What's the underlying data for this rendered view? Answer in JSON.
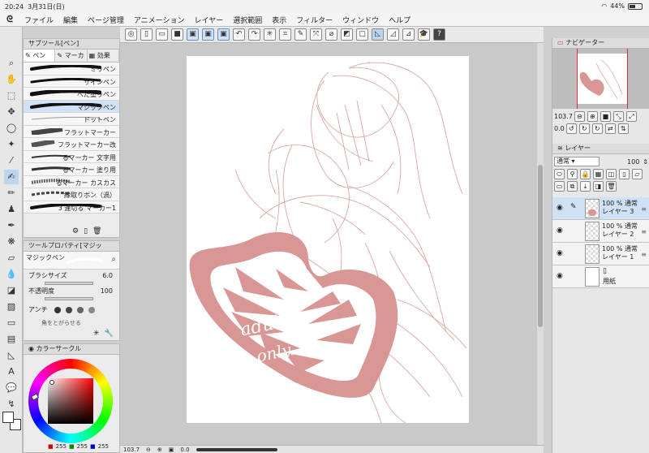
{
  "status": {
    "time": "20:24",
    "date": "3月31日(日)",
    "battery": "44%"
  },
  "menu": [
    "ファイル",
    "編集",
    "ページ管理",
    "アニメーション",
    "レイヤー",
    "選択範囲",
    "表示",
    "フィルター",
    "ウィンドウ",
    "ヘルプ"
  ],
  "subtool": {
    "header": "サブツール[ペン]",
    "tabs": [
      "ペン",
      "マーカ",
      "効果"
    ],
    "brushes": [
      "ミリペン",
      "サインペン",
      "べた塗りペン",
      "マジックペン",
      "ドットペン",
      "フラットマーカー",
      "フラットマーカー改",
      "るマーカー 文字用",
      "るマーカー 塗り用",
      "るマーカー カスカス",
      "縁取りボン（渦）",
      "3 連切る マーカー1"
    ]
  },
  "toolprop": {
    "header": "ツールプロパティ[マジッ",
    "brush_name": "マジックペン",
    "size_label": "ブラシサイズ",
    "size_value": "6.0",
    "opacity_label": "不透明度",
    "opacity_value": "100",
    "aa_label": "アンチ",
    "extra_label": "角をとがらせる"
  },
  "color": {
    "header": "カラーサークル",
    "r": "255",
    "g": "255",
    "b": "255",
    "accent": "#d89694"
  },
  "canvas": {
    "text_line1": "adult",
    "text_line2": "only...",
    "sketch_color": "#d89694"
  },
  "bottom": {
    "zoom": "103.7",
    "angle": "0.0"
  },
  "navigator": {
    "header": "ナビゲーター",
    "zoom": "103.7",
    "angle": "0.0"
  },
  "layers": {
    "header": "レイヤー",
    "blend": "通常",
    "opacity": "100",
    "items": [
      {
        "pct": "100 %",
        "mode": "通常",
        "name": "レイヤー 3"
      },
      {
        "pct": "100 %",
        "mode": "通常",
        "name": "レイヤー 2"
      },
      {
        "pct": "100 %",
        "mode": "通常",
        "name": "レイヤー 1"
      },
      {
        "pct": "",
        "mode": "",
        "name": "用紙"
      }
    ]
  }
}
